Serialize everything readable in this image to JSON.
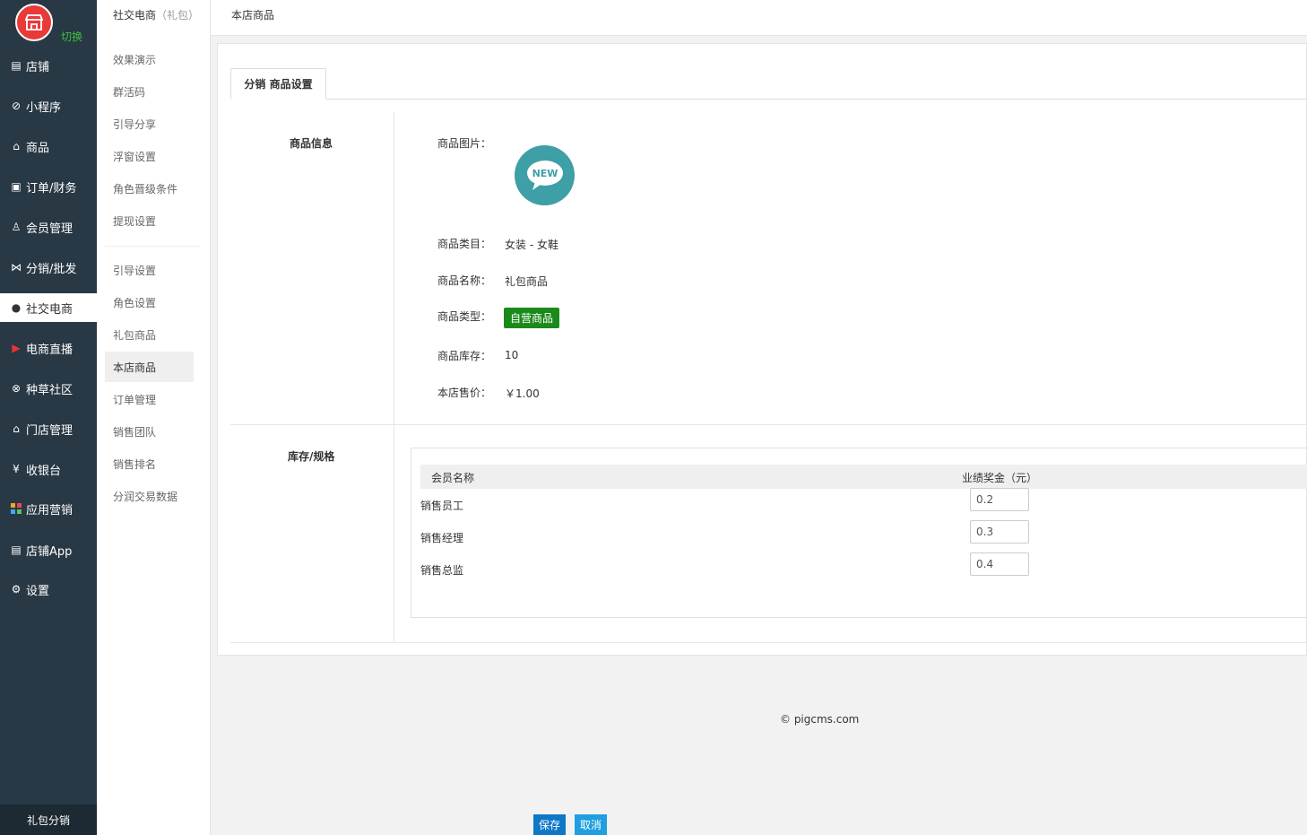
{
  "sidebar": {
    "switch_label": "切换",
    "items": [
      {
        "label": "店铺",
        "icon": "shop-icon"
      },
      {
        "label": "小程序",
        "icon": "miniprogram-icon"
      },
      {
        "label": "商品",
        "icon": "bag-icon"
      },
      {
        "label": "订单/财务",
        "icon": "order-icon"
      },
      {
        "label": "会员管理",
        "icon": "members-icon"
      },
      {
        "label": "分销/批发",
        "icon": "share-icon"
      },
      {
        "label": "社交电商",
        "icon": "wechat-icon"
      },
      {
        "label": "电商直播",
        "icon": "live-icon"
      },
      {
        "label": "种草社区",
        "icon": "community-icon"
      },
      {
        "label": "门店管理",
        "icon": "store-icon"
      },
      {
        "label": "收银台",
        "icon": "cashier-icon"
      },
      {
        "label": "应用营销",
        "icon": "apps-icon"
      },
      {
        "label": "店铺App",
        "icon": "app-icon"
      },
      {
        "label": "设置",
        "icon": "gear-icon"
      }
    ],
    "bottom_label": "礼包分销"
  },
  "submenu": {
    "head": "社交电商",
    "head_sub": "（礼包）",
    "group1": [
      "效果演示",
      "群活码",
      "引导分享",
      "浮窗设置",
      "角色晋级条件",
      "提现设置"
    ],
    "group2": [
      "引导设置",
      "角色设置",
      "礼包商品",
      "本店商品",
      "订单管理",
      "销售团队",
      "销售排名",
      "分润交易数据"
    ]
  },
  "topbar": {
    "title": "本店商品"
  },
  "tab": {
    "label": "分销 商品设置"
  },
  "product_section": {
    "title": "商品信息",
    "image_label": "商品图片：",
    "image_text": "NEW",
    "category_label": "商品类目：",
    "category_value": "女装 - 女鞋",
    "name_label": "商品名称：",
    "name_value": "礼包商品",
    "type_label": "商品类型：",
    "type_value": "自营商品",
    "stock_label": "商品库存：",
    "stock_value": "10",
    "price_label": "本店售价：",
    "price_value": "￥1.00"
  },
  "spec_section": {
    "title": "库存/规格",
    "col_member": "会员名称",
    "col_bonus": "业绩奖金（元）",
    "rows": [
      {
        "member": "销售员工",
        "bonus": "0.2"
      },
      {
        "member": "销售经理",
        "bonus": "0.3"
      },
      {
        "member": "销售总监",
        "bonus": "0.4"
      }
    ]
  },
  "footer": {
    "copyright": "© pigcms.com"
  },
  "actions": {
    "save": "保存",
    "cancel": "取消"
  }
}
